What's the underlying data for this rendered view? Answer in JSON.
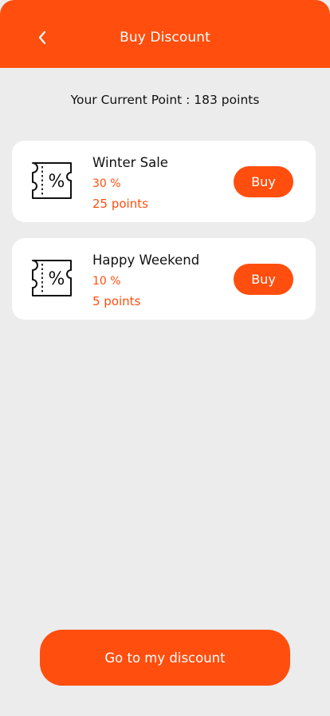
{
  "header": {
    "title": "Buy Discount",
    "back_icon": "chevron-left-icon"
  },
  "summary": {
    "points_text": "Your Current Point : 183 points"
  },
  "discounts": [
    {
      "name": "Winter Sale",
      "percent": "30 %",
      "cost": "25 points",
      "icon": "discount-ticket-icon",
      "buy_label": "Buy"
    },
    {
      "name": "Happy Weekend",
      "percent": "10 %",
      "cost": "5 points",
      "icon": "discount-ticket-icon",
      "buy_label": "Buy"
    }
  ],
  "footer": {
    "button_label": "Go to my discount"
  },
  "colors": {
    "accent": "#FF4E0E",
    "background": "#ECECEC",
    "card": "#FFFFFF"
  }
}
